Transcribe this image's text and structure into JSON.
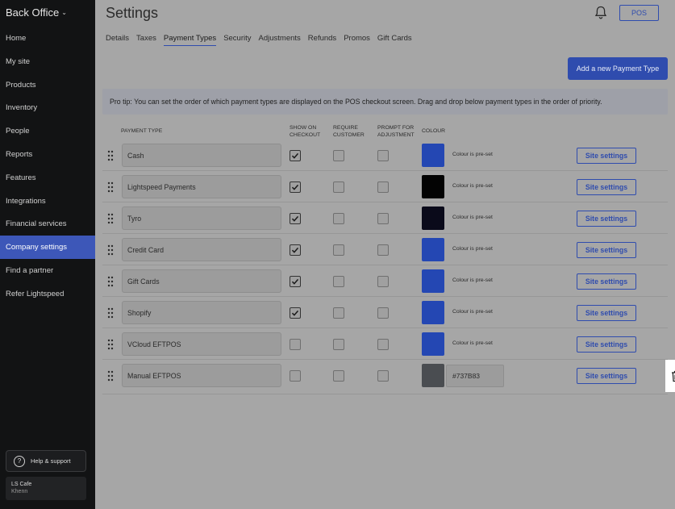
{
  "sidebar": {
    "brand": "Back Office",
    "items": [
      {
        "label": "Home"
      },
      {
        "label": "My site"
      },
      {
        "label": "Products"
      },
      {
        "label": "Inventory"
      },
      {
        "label": "People"
      },
      {
        "label": "Reports"
      },
      {
        "label": "Features"
      },
      {
        "label": "Integrations"
      },
      {
        "label": "Financial services"
      },
      {
        "label": "Company settings",
        "active": true
      },
      {
        "label": "Find a partner"
      },
      {
        "label": "Refer Lightspeed"
      }
    ],
    "help_label": "Help & support",
    "account": {
      "name": "LS Cafe",
      "user": "Khenn"
    }
  },
  "header": {
    "title": "Settings",
    "pos_label": "POS",
    "tabs": [
      {
        "label": "Details"
      },
      {
        "label": "Taxes"
      },
      {
        "label": "Payment Types",
        "active": true
      },
      {
        "label": "Security"
      },
      {
        "label": "Adjustments"
      },
      {
        "label": "Refunds"
      },
      {
        "label": "Promos"
      },
      {
        "label": "Gift Cards"
      }
    ]
  },
  "actions": {
    "add_label": "Add a new Payment Type"
  },
  "tip": "Pro tip: You can set the order of which payment types are displayed on the POS checkout screen. Drag and drop below payment types in the order of priority.",
  "table": {
    "headers": {
      "type": "PAYMENT TYPE",
      "show_l1": "SHOW ON",
      "show_l2": "CHECKOUT",
      "req_l1": "REQUIRE",
      "req_l2": "CUSTOMER",
      "adj_l1": "PROMPT FOR",
      "adj_l2": "ADJUSTMENT",
      "colour": "COLOUR"
    },
    "preset_label": "Colour is pre-set",
    "site_label": "Site settings",
    "rows": [
      {
        "name": "Cash",
        "show": true,
        "require": false,
        "prompt": false,
        "colour": "#2447b3"
      },
      {
        "name": "Lightspeed Payments",
        "show": true,
        "require": false,
        "prompt": false,
        "colour": "#030303"
      },
      {
        "name": "Tyro",
        "show": true,
        "require": false,
        "prompt": false,
        "colour": "#0a0a1a"
      },
      {
        "name": "Credit Card",
        "show": true,
        "require": false,
        "prompt": false,
        "colour": "#2447b3"
      },
      {
        "name": "Gift Cards",
        "show": true,
        "require": false,
        "prompt": false,
        "colour": "#2447b3"
      },
      {
        "name": "Shopify",
        "show": true,
        "require": false,
        "prompt": false,
        "colour": "#2447b3"
      },
      {
        "name": "VCloud EFTPOS",
        "show": false,
        "require": false,
        "prompt": false,
        "colour": "#2447b3"
      },
      {
        "name": "Manual EFTPOS",
        "show": false,
        "require": false,
        "prompt": false,
        "colour": "#4a4d51",
        "hex": "#737B83",
        "deletable": true
      }
    ]
  }
}
